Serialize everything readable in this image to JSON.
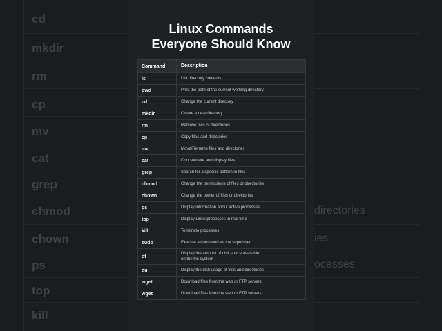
{
  "title": {
    "line1": "Linux Commands",
    "line2": "Everyone Should Know"
  },
  "table": {
    "headers": {
      "command": "Command",
      "description": "Description"
    },
    "rows": [
      {
        "cmd": "ls",
        "desc": "List directory contents"
      },
      {
        "cmd": "pwd",
        "desc": "Print the path of the current working directory"
      },
      {
        "cmd": "cd",
        "desc": "Change the current directory"
      },
      {
        "cmd": "mkdir",
        "desc": "Create a new directory"
      },
      {
        "cmd": "rm",
        "desc": "Remove files or directories"
      },
      {
        "cmd": "cp",
        "desc": "Copy files and directories"
      },
      {
        "cmd": "mv",
        "desc": "Move/Rename files and directories"
      },
      {
        "cmd": "cat",
        "desc": "Concatenate and display files"
      },
      {
        "cmd": "grep",
        "desc": "Search for a specific pattern in files"
      },
      {
        "cmd": "chmod",
        "desc": "Change the permissions of files or directories"
      },
      {
        "cmd": "chown",
        "desc": "Change the owner of files or directories"
      },
      {
        "cmd": "ps",
        "desc": "Display information about active processes"
      },
      {
        "cmd": "top",
        "desc": "Display Linux processes in real time"
      },
      {
        "cmd": "kill",
        "desc": "Terminate processes"
      },
      {
        "cmd": "sudo",
        "desc": "Execute a command as the superuser"
      },
      {
        "cmd": "df",
        "desc": "Display the amount of disk space available",
        "desc2": "on the file system"
      },
      {
        "cmd": "du",
        "desc": "Display the disk usage of files and directories"
      },
      {
        "cmd": "wget",
        "desc": "Download files from the web or FTP servers"
      },
      {
        "cmd": "wget",
        "desc": "Download files from the web or FTP servers"
      }
    ]
  },
  "background_left": [
    "cd",
    "mkdir",
    "rm",
    "cp",
    "mv",
    "cat",
    "grep",
    "chmod",
    "chown",
    "ps",
    "top",
    "kill"
  ],
  "background_right": [
    "directories",
    "ies",
    "ocesses"
  ]
}
